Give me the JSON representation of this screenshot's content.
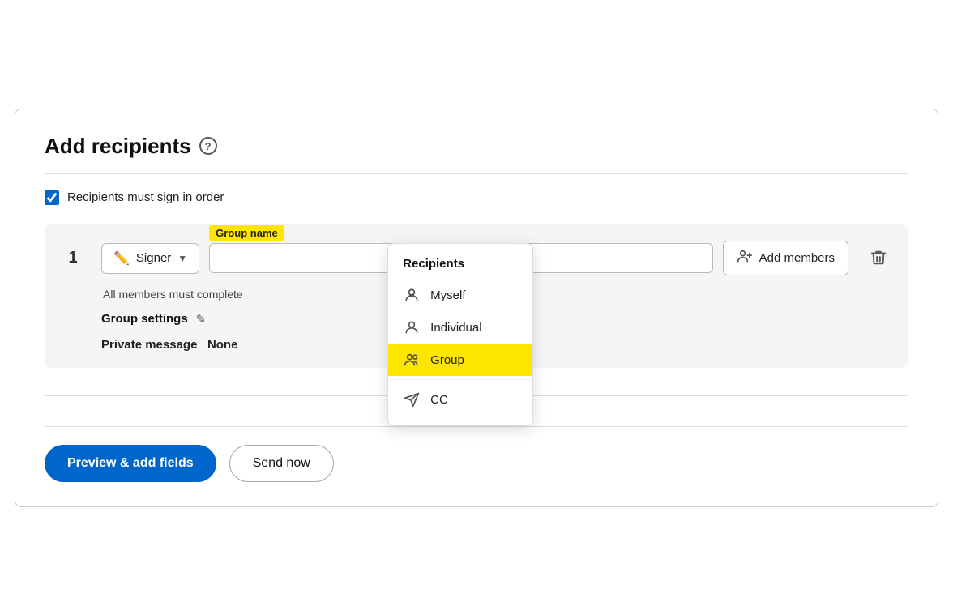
{
  "page": {
    "title": "Add recipients",
    "help_icon_label": "?",
    "divider": true
  },
  "checkbox": {
    "label": "Recipients must sign in order",
    "checked": true
  },
  "recipient_row": {
    "number": "1",
    "signer_label": "Signer",
    "group_name_label": "Group name",
    "group_name_placeholder": "",
    "add_members_label": "Add members",
    "all_members_text": "All members must complete",
    "group_settings_label": "Group settings",
    "private_message_label": "Private message",
    "private_message_value": "None"
  },
  "dropdown": {
    "header": "Recipients",
    "items": [
      {
        "id": "myself",
        "label": "Myself",
        "selected": false
      },
      {
        "id": "individual",
        "label": "Individual",
        "selected": false
      },
      {
        "id": "group",
        "label": "Group",
        "selected": true
      },
      {
        "id": "cc",
        "label": "CC",
        "selected": false
      }
    ]
  },
  "footer": {
    "preview_label": "Preview & add fields",
    "send_now_label": "Send now"
  },
  "colors": {
    "accent_blue": "#0066cc",
    "highlight_yellow": "#ffe600",
    "border": "#bbb",
    "bg_card": "#f5f5f5"
  }
}
